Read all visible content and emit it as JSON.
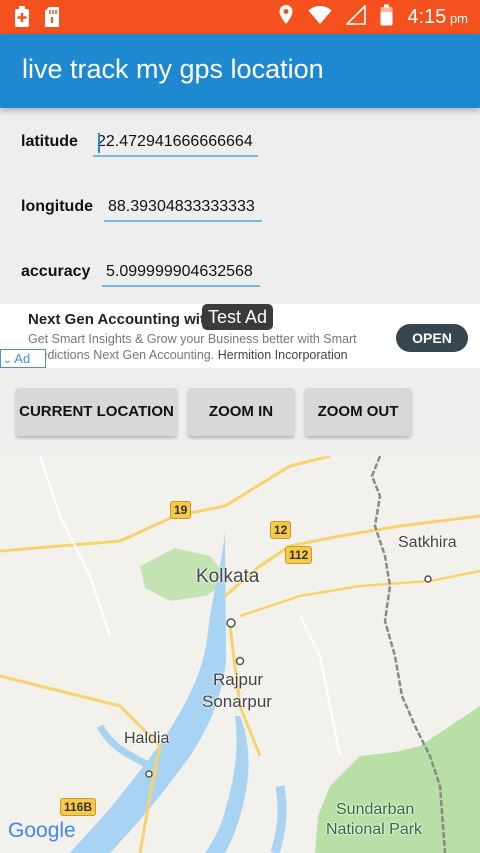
{
  "status_bar": {
    "time": "4:15",
    "ampm": "pm",
    "icons": [
      "battery-saver-icon",
      "sd-card-icon",
      "location-icon",
      "wifi-icon",
      "signal-icon",
      "battery-icon"
    ]
  },
  "app_bar": {
    "title": "live track my gps location"
  },
  "fields": {
    "latitude": {
      "label": "latitude",
      "value": "22.472941666666664"
    },
    "longitude": {
      "label": "longitude",
      "value": "88.39304833333333"
    },
    "accuracy": {
      "label": "accuracy",
      "value": "5.099999904632568"
    }
  },
  "ad": {
    "title": "Next Gen Accounting wit",
    "description": "Get Smart Insights & Grow your Business better with Smart Predictions Next Gen Accounting.",
    "advertiser": "Hermition Incorporation",
    "open_label": "OPEN",
    "badge_label": "Ad",
    "test_label": "Test Ad"
  },
  "buttons": {
    "current_location": "CURRENT LOCATION",
    "zoom_in": "ZOOM IN",
    "zoom_out": "ZOOM OUT"
  },
  "map": {
    "labels": {
      "kolkata": "Kolkata",
      "satkhira": "Satkhira",
      "rajpur": "Rajpur",
      "sonarpur": "Sonarpur",
      "haldia": "Haldia",
      "sundarban_1": "Sundarban",
      "sundarban_2": "National Park"
    },
    "road_shields": {
      "r19": "19",
      "r12": "12",
      "r112": "112",
      "r116b": "116B"
    },
    "google": "Google"
  },
  "colors": {
    "status_bar": "#f4511e",
    "app_bar": "#1e88d0",
    "water": "#a9d3f2",
    "park": "#b8dfa6",
    "road": "#f7c948"
  }
}
